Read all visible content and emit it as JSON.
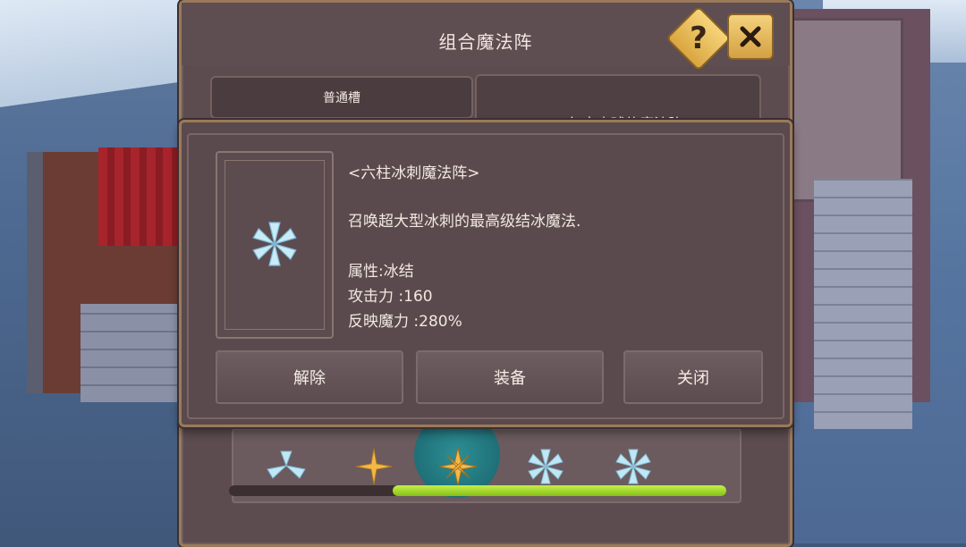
{
  "dialog": {
    "title": "组合魔法阵",
    "slot_tab": "普通槽",
    "slot_right_text": "[ 五气中击球体魔法阵 ]",
    "help_icon": "?",
    "close_icon": "×"
  },
  "modal": {
    "spell_name": "<六柱冰刺魔法阵>",
    "description": "召唤超大型冰刺的最高级结冰魔法.",
    "attribute": "属性:冰结",
    "attack": "攻击力 :160",
    "reflect": "反映魔力 :280%",
    "buttons": {
      "release": "解除",
      "equip": "装备",
      "close": "关闭"
    }
  },
  "strip": {
    "icons": [
      "tri-blade-ice-icon",
      "four-point-star-gold-icon",
      "cross-spike-gold-icon",
      "ice-flower-icon",
      "ice-flower-icon"
    ],
    "selected_index": 2,
    "scroll_fraction": 0.67
  },
  "colors": {
    "accent_gold": "#d9a640",
    "panel": "#5a4a4d",
    "scroll_green": "#a6d82c",
    "ice": "#bfe7f5"
  }
}
